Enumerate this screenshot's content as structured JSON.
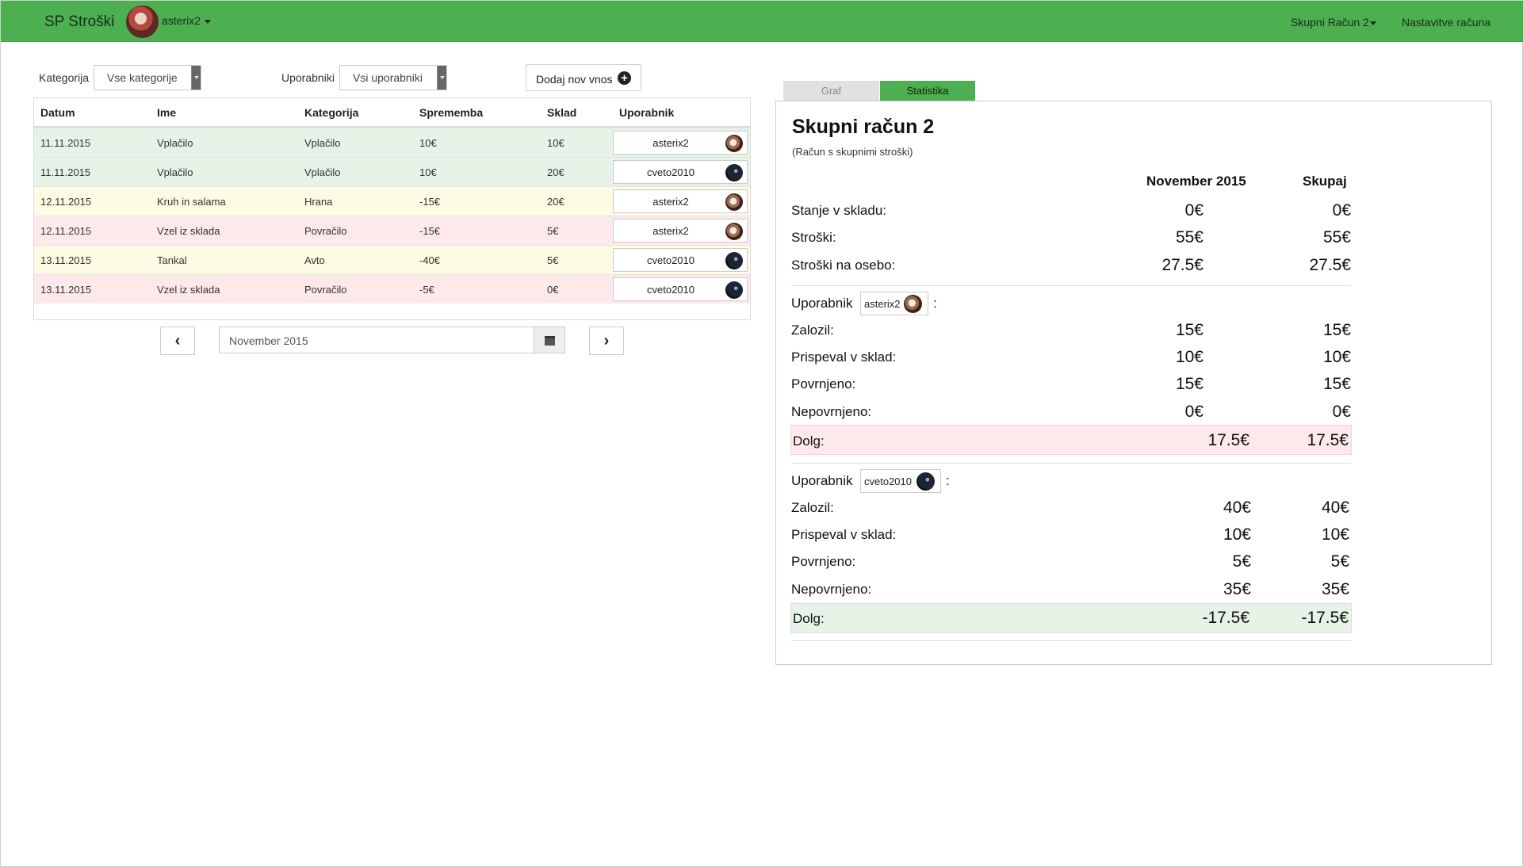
{
  "navbar": {
    "brand": "SP Stroški",
    "user": "asterix2",
    "account": "Skupni Račun 2",
    "settings": "Nastavitve računa"
  },
  "filters": {
    "category_label": "Kategorija",
    "category_value": "Vse kategorije",
    "users_label": "Uporabniki",
    "users_value": "Vsi uporabniki",
    "add_button": "Dodaj nov vnos"
  },
  "table": {
    "headers": [
      "Datum",
      "Ime",
      "Kategorija",
      "Sprememba",
      "Sklad",
      "Uporabnik"
    ],
    "rows": [
      {
        "date": "11.11.2015",
        "name": "Vplačilo",
        "category": "Vplačilo",
        "change": "10€",
        "fund": "10€",
        "user": "asterix2",
        "status": "success"
      },
      {
        "date": "11.11.2015",
        "name": "Vplačilo",
        "category": "Vplačilo",
        "change": "10€",
        "fund": "20€",
        "user": "cveto2010",
        "status": "success"
      },
      {
        "date": "12.11.2015",
        "name": "Kruh in salama",
        "category": "Hrana",
        "change": "-15€",
        "fund": "20€",
        "user": "asterix2",
        "status": "warning"
      },
      {
        "date": "12.11.2015",
        "name": "Vzel iz sklada",
        "category": "Povračilo",
        "change": "-15€",
        "fund": "5€",
        "user": "asterix2",
        "status": "danger"
      },
      {
        "date": "13.11.2015",
        "name": "Tankal",
        "category": "Avto",
        "change": "-40€",
        "fund": "5€",
        "user": "cveto2010",
        "status": "warning"
      },
      {
        "date": "13.11.2015",
        "name": "Vzel iz sklada",
        "category": "Povračilo",
        "change": "-5€",
        "fund": "0€",
        "user": "cveto2010",
        "status": "danger"
      }
    ]
  },
  "pager": {
    "month": "November 2015",
    "prev_icon": "chevron-left-icon",
    "next_icon": "chevron-right-icon",
    "calendar_icon": "calendar-icon"
  },
  "tabs": [
    "Graf",
    "Statistika"
  ],
  "stats": {
    "title": "Skupni račun 2",
    "subtitle": "(Račun s skupnimi stroški)",
    "col_month": "November 2015",
    "col_total": "Skupaj",
    "summary": [
      {
        "label": "Stanje v skladu:",
        "month": "0€",
        "total": "0€"
      },
      {
        "label": "Stroški:",
        "month": "55€",
        "total": "55€"
      },
      {
        "label": "Stroški na osebo:",
        "month": "27.5€",
        "total": "27.5€"
      }
    ],
    "users": [
      {
        "prefix": "Uporabnik",
        "name": "asterix2",
        "suffix": ":",
        "rows": [
          {
            "label": "Zalozil:",
            "month": "15€",
            "total": "15€"
          },
          {
            "label": "Prispeval v sklad:",
            "month": "10€",
            "total": "10€"
          },
          {
            "label": "Povrnjeno:",
            "month": "15€",
            "total": "15€"
          },
          {
            "label": "Nepovrnjeno:",
            "month": "0€",
            "total": "0€"
          }
        ],
        "debt_label": "Dolg:",
        "debt_month": "17.5€",
        "debt_total": "17.5€"
      },
      {
        "prefix": "Uporabnik",
        "name": "cveto2010",
        "suffix": ":",
        "rows": [
          {
            "label": "Zalozil:",
            "month": "40€",
            "total": "40€"
          },
          {
            "label": "Prispeval v sklad:",
            "month": "10€",
            "total": "10€"
          },
          {
            "label": "Povrnjeno:",
            "month": "5€",
            "total": "5€"
          },
          {
            "label": "Nepovrnjeno:",
            "month": "35€",
            "total": "35€"
          }
        ],
        "debt_label": "Dolg:",
        "debt_month": "-17.5€",
        "debt_total": "-17.5€"
      }
    ]
  }
}
